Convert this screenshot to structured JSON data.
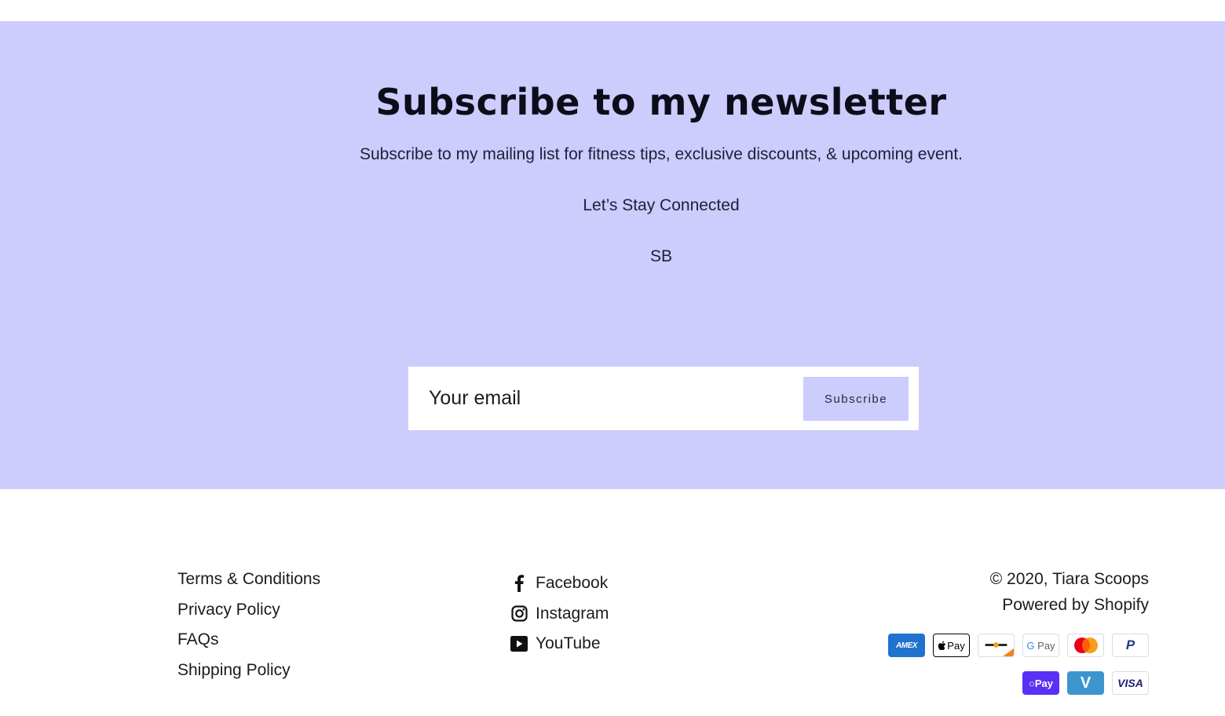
{
  "newsletter": {
    "title": "Subscribe to my newsletter",
    "subtitle": "Subscribe to my mailing list for fitness tips, exclusive discounts, & upcoming event.",
    "connect": "Let’s Stay Connected",
    "signature": "SB",
    "email_placeholder": "Your email",
    "button_label": "Subscribe",
    "background_color": "#ccccfd"
  },
  "footer": {
    "links": [
      {
        "label": "Terms & Conditions"
      },
      {
        "label": "Privacy Policy"
      },
      {
        "label": "FAQs"
      },
      {
        "label": "Shipping Policy"
      }
    ],
    "social": [
      {
        "label": "Facebook",
        "icon": "facebook-icon"
      },
      {
        "label": "Instagram",
        "icon": "instagram-icon"
      },
      {
        "label": "YouTube",
        "icon": "youtube-icon"
      }
    ],
    "copyright": "© 2020, Tiara Scoops",
    "powered": "Powered by Shopify",
    "payments": {
      "amex": "AMEX",
      "apple_pay": "Pay",
      "google_pay": "G Pay",
      "paypal": "P",
      "shop_pay": "Pay",
      "venmo": "V",
      "visa": "VISA"
    }
  }
}
